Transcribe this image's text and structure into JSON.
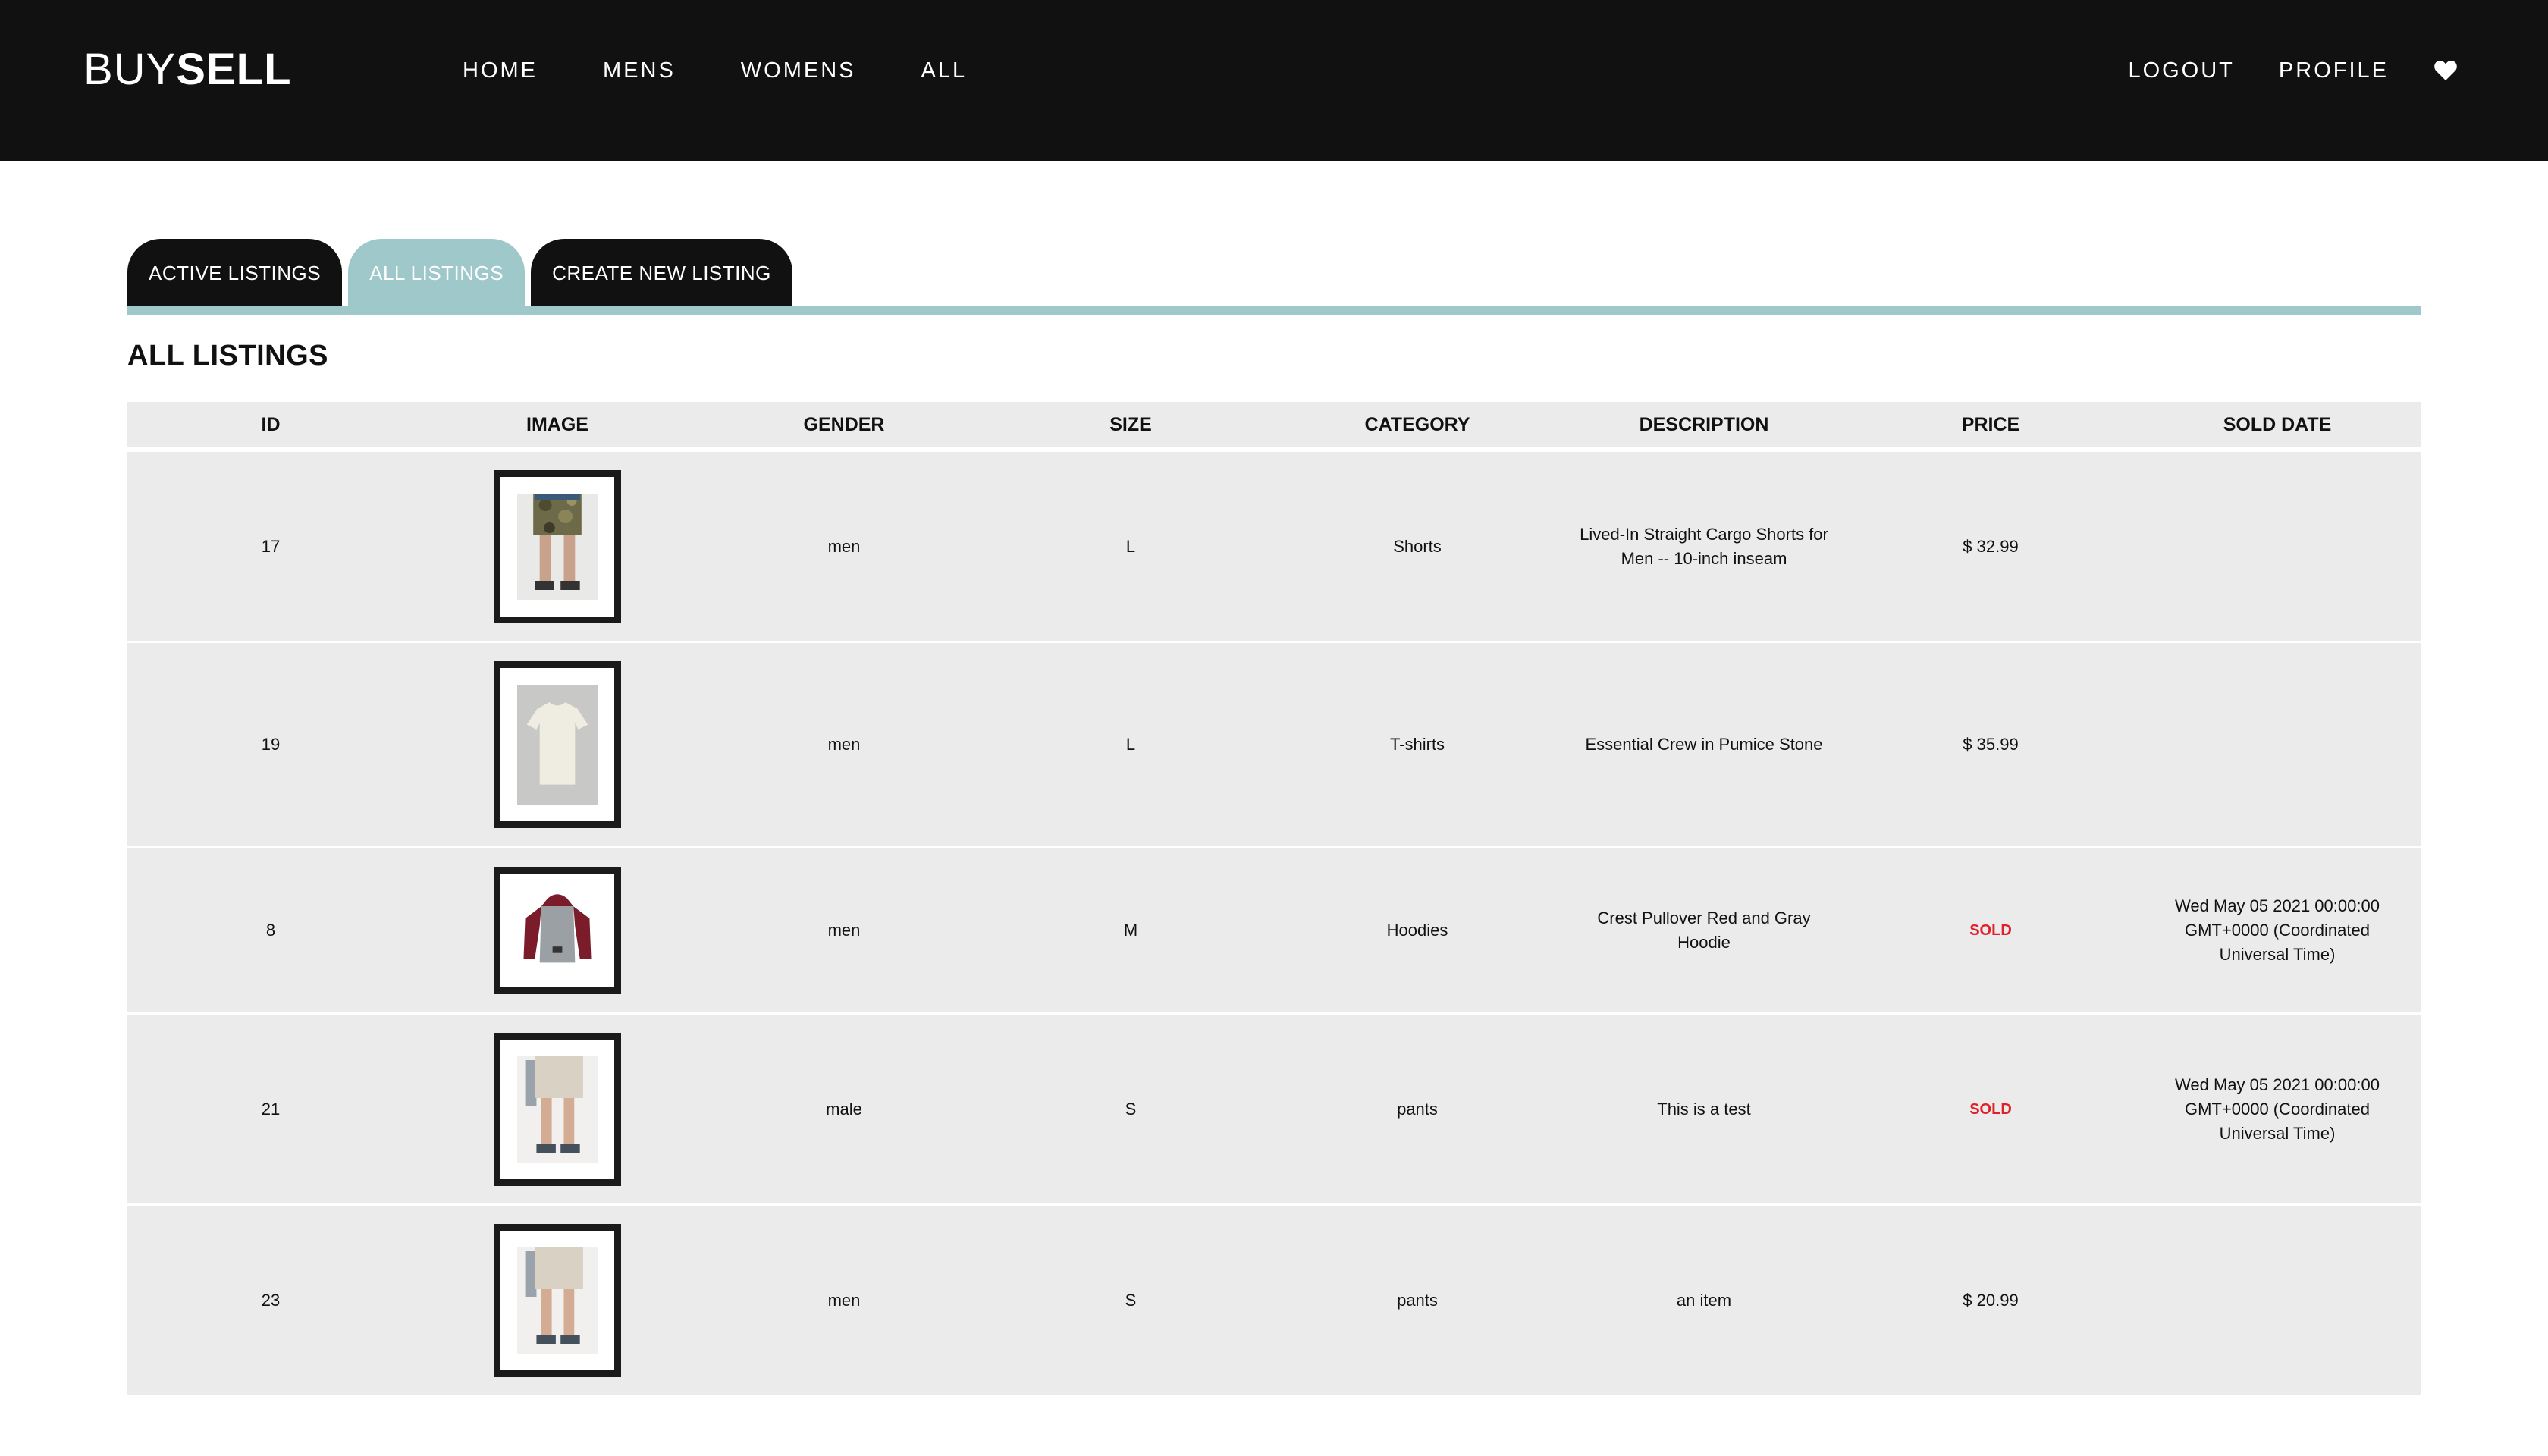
{
  "brand": {
    "light": "BUY",
    "bold": "SELL"
  },
  "nav": {
    "left": [
      "HOME",
      "MENS",
      "WOMENS",
      "ALL"
    ],
    "logout": "LOGOUT",
    "profile": "PROFILE"
  },
  "tabs": {
    "active_listings": "ACTIVE LISTINGS",
    "all_listings": "ALL LISTINGS",
    "create_new": "CREATE NEW LISTING",
    "selected": "ALL LISTINGS"
  },
  "page_title": "ALL LISTINGS",
  "table": {
    "headers": [
      "ID",
      "IMAGE",
      "GENDER",
      "SIZE",
      "CATEGORY",
      "DESCRIPTION",
      "PRICE",
      "SOLD DATE"
    ],
    "rows": [
      {
        "id": "17",
        "image": "camo-cargo-shorts",
        "gender": "men",
        "size": "L",
        "category": "Shorts",
        "description": "Lived-In Straight Cargo Shorts for Men -- 10-inch inseam",
        "price": "$ 32.99",
        "sold_date": ""
      },
      {
        "id": "19",
        "image": "cream-crew-tshirt",
        "gender": "men",
        "size": "L",
        "category": "T-shirts",
        "description": "Essential Crew in Pumice Stone",
        "price": "$ 35.99",
        "sold_date": ""
      },
      {
        "id": "8",
        "image": "red-gray-hoodie",
        "gender": "men",
        "size": "M",
        "category": "Hoodies",
        "description": "Crest Pullover Red and Gray Hoodie",
        "price": "SOLD",
        "sold_date": "Wed May 05 2021 00:00:00 GMT+0000 (Coordinated Universal Time)"
      },
      {
        "id": "21",
        "image": "khaki-shorts",
        "gender": "male",
        "size": "S",
        "category": "pants",
        "description": "This is a test",
        "price": "SOLD",
        "sold_date": "Wed May 05 2021 00:00:00 GMT+0000 (Coordinated Universal Time)"
      },
      {
        "id": "23",
        "image": "khaki-shorts",
        "gender": "men",
        "size": "S",
        "category": "pants",
        "description": "an item",
        "price": "$ 20.99",
        "sold_date": ""
      }
    ]
  },
  "colors": {
    "header_bg": "#111111",
    "accent_teal": "#9ec8c9",
    "row_bg": "#ebebeb",
    "sold_red": "#e0202a"
  },
  "icons": {
    "wishlist": "heart-icon"
  }
}
